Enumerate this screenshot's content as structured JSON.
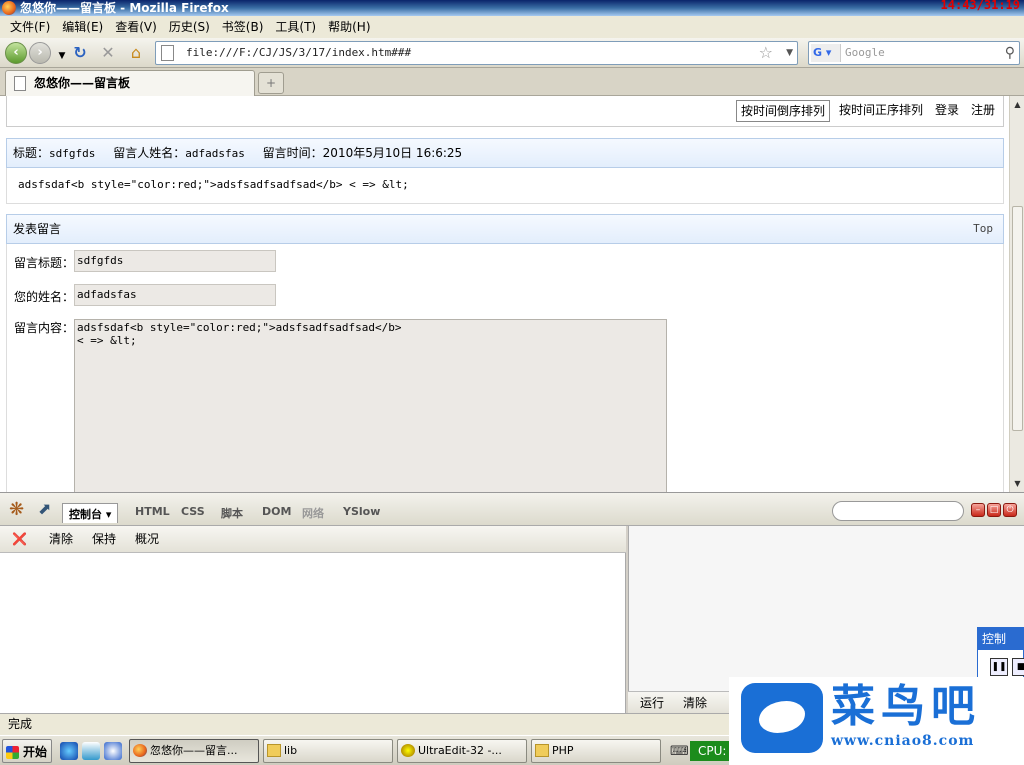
{
  "window": {
    "title": "忽悠你——留言板 - Mozilla Firefox",
    "clock": "14:43/31:19"
  },
  "menu": [
    "文件(F)",
    "编辑(E)",
    "查看(V)",
    "历史(S)",
    "书签(B)",
    "工具(T)",
    "帮助(H)"
  ],
  "navbar": {
    "url": "file:///F:/CJ/JS/3/17/index.htm###",
    "search_placeholder": "Google",
    "search_engine": "G"
  },
  "tabs": [
    {
      "label": "忽悠你——留言板"
    }
  ],
  "page": {
    "top_links": [
      "按时间倒序排列",
      "按时间正序排列",
      "登录",
      "注册"
    ],
    "message": {
      "title_label": "标题：",
      "title": "sdfgfds",
      "author_label": "留言人姓名：",
      "author": "adfadsfas",
      "time_label": "留言时间：",
      "time": "2010年5月10日 16:6:25",
      "body": "adsfsdaf<b style=\"color:red;\">adsfsadfsadfsad</b> < => &lt;"
    },
    "form": {
      "heading": "发表留言",
      "top_link": "Top",
      "title_label": "留言标题：",
      "title_value": "sdfgfds",
      "name_label": "您的姓名：",
      "name_value": "adfadsfas",
      "content_label": "留言内容：",
      "content_value": "adsfsdaf<b style=\"color:red;\">adsfsadfsadfsad</b>\n< => &lt;"
    }
  },
  "firebug": {
    "tabs": [
      "控制台",
      "HTML",
      "CSS",
      "脚本",
      "DOM",
      "网络",
      "YSlow"
    ],
    "console_commands": [
      "清除",
      "保持",
      "概况"
    ],
    "side_commands": [
      "运行",
      "清除"
    ]
  },
  "status": "完成",
  "taskbar": {
    "start": "开始",
    "tasks": [
      "忽悠你——留言...",
      "lib",
      "UltraEdit-32 -...",
      "PHP"
    ],
    "cpu": "CPU:"
  },
  "control_panel": {
    "title": "控制"
  },
  "watermark": {
    "text": "菜鸟吧",
    "url": "www.cniao8.com"
  }
}
